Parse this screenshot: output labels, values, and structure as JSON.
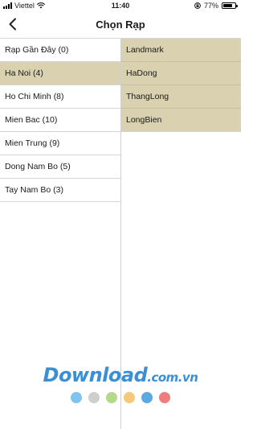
{
  "status_bar": {
    "carrier": "Viettel",
    "time": "11:40",
    "battery_percent": "77%",
    "battery_level": 0.77
  },
  "nav": {
    "title": "Chọn Rạp"
  },
  "left_list": {
    "items": [
      {
        "label": "Rạp Gần Đây (0)"
      },
      {
        "label": "Ha Noi (4)",
        "selected": true
      },
      {
        "label": "Ho Chi Minh (8)"
      },
      {
        "label": "Mien Bac (10)"
      },
      {
        "label": "Mien Trung (9)"
      },
      {
        "label": "Dong Nam Bo (5)"
      },
      {
        "label": "Tay Nam Bo (3)"
      }
    ]
  },
  "right_list": {
    "items": [
      {
        "label": "Landmark"
      },
      {
        "label": "HaDong"
      },
      {
        "label": "ThangLong"
      },
      {
        "label": "LongBien"
      }
    ]
  },
  "watermark": {
    "brand": "Download",
    "domain": ".com.vn"
  },
  "colors": {
    "selected_bg": "#d9d1b0",
    "watermark_blue": "#3b8fd4",
    "dots": [
      "#7fc4ee",
      "#cfcfcf",
      "#b5d98a",
      "#f5c97a",
      "#5aa9e0",
      "#ef7d7d"
    ]
  }
}
